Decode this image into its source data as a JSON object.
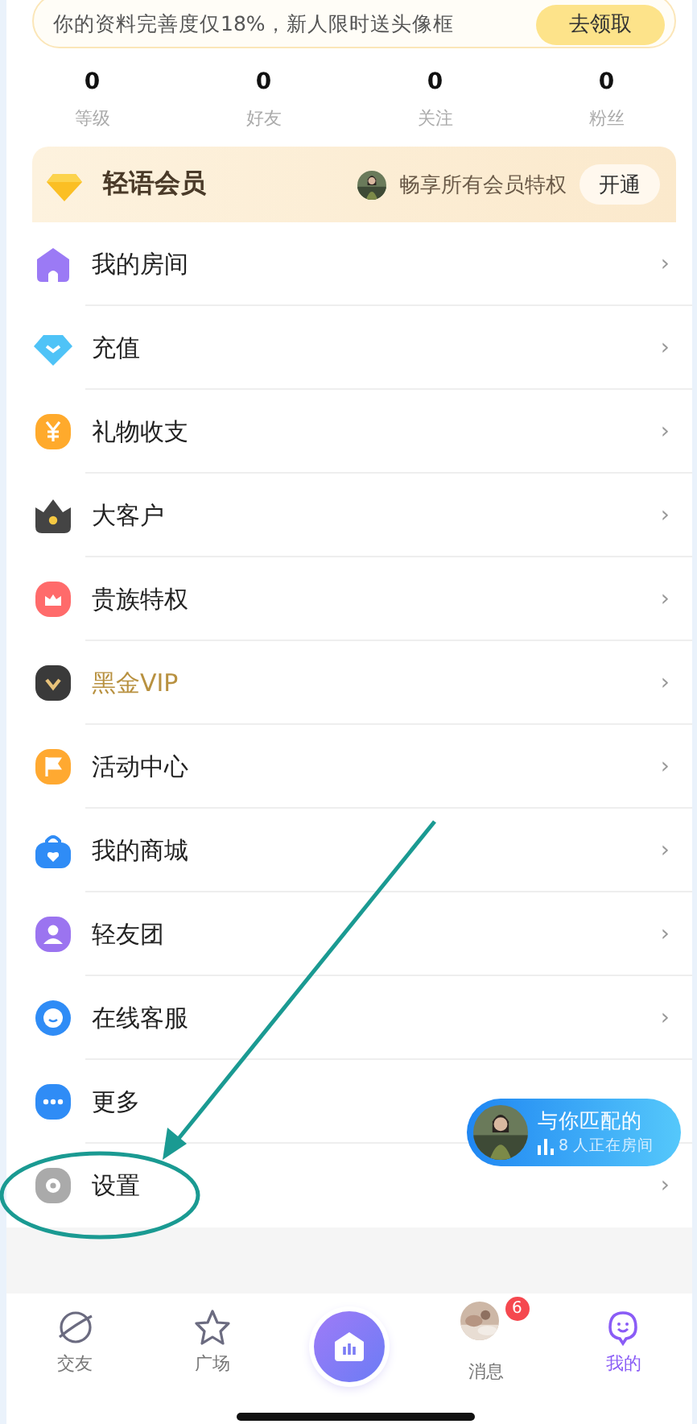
{
  "banner": {
    "text": "你的资料完善度仅18%，新人限时送头像框",
    "button": "去领取"
  },
  "stats": [
    {
      "value": "0",
      "label": "等级"
    },
    {
      "value": "0",
      "label": "好友"
    },
    {
      "value": "0",
      "label": "关注"
    },
    {
      "value": "0",
      "label": "粉丝"
    }
  ],
  "member_card": {
    "title": "轻语会员",
    "perk": "畅享所有会员特权",
    "button": "开通"
  },
  "menu": [
    {
      "label": "我的房间",
      "kind": "normal",
      "chevron": "›"
    },
    {
      "label": "充值",
      "kind": "normal",
      "chevron": "›"
    },
    {
      "label": "礼物收支",
      "kind": "normal",
      "chevron": "›"
    },
    {
      "label": "大客户",
      "kind": "normal",
      "chevron": "›"
    },
    {
      "label": "贵族特权",
      "kind": "normal",
      "chevron": "›"
    },
    {
      "label": "黑金VIP",
      "kind": "gold",
      "chevron": "›"
    },
    {
      "label": "活动中心",
      "kind": "normal",
      "chevron": "›"
    },
    {
      "label": "我的商城",
      "kind": "normal",
      "chevron": "›"
    },
    {
      "label": "轻友团",
      "kind": "normal",
      "chevron": "›"
    },
    {
      "label": "在线客服",
      "kind": "normal",
      "chevron": "›"
    },
    {
      "label": "更多",
      "kind": "normal"
    },
    {
      "label": "设置",
      "kind": "normal",
      "chevron": "›"
    }
  ],
  "match_card": {
    "title": "与你匹配的",
    "subtitle": "8 人正在房间"
  },
  "nav": [
    {
      "label": "交友",
      "kind": "tab",
      "selected": false
    },
    {
      "label": "广场",
      "kind": "tab",
      "selected": false
    },
    {
      "kind": "center"
    },
    {
      "label": "消息",
      "kind": "avatar",
      "badge": "6",
      "selected": false
    },
    {
      "label": "我的",
      "kind": "tab",
      "selected": true
    }
  ]
}
